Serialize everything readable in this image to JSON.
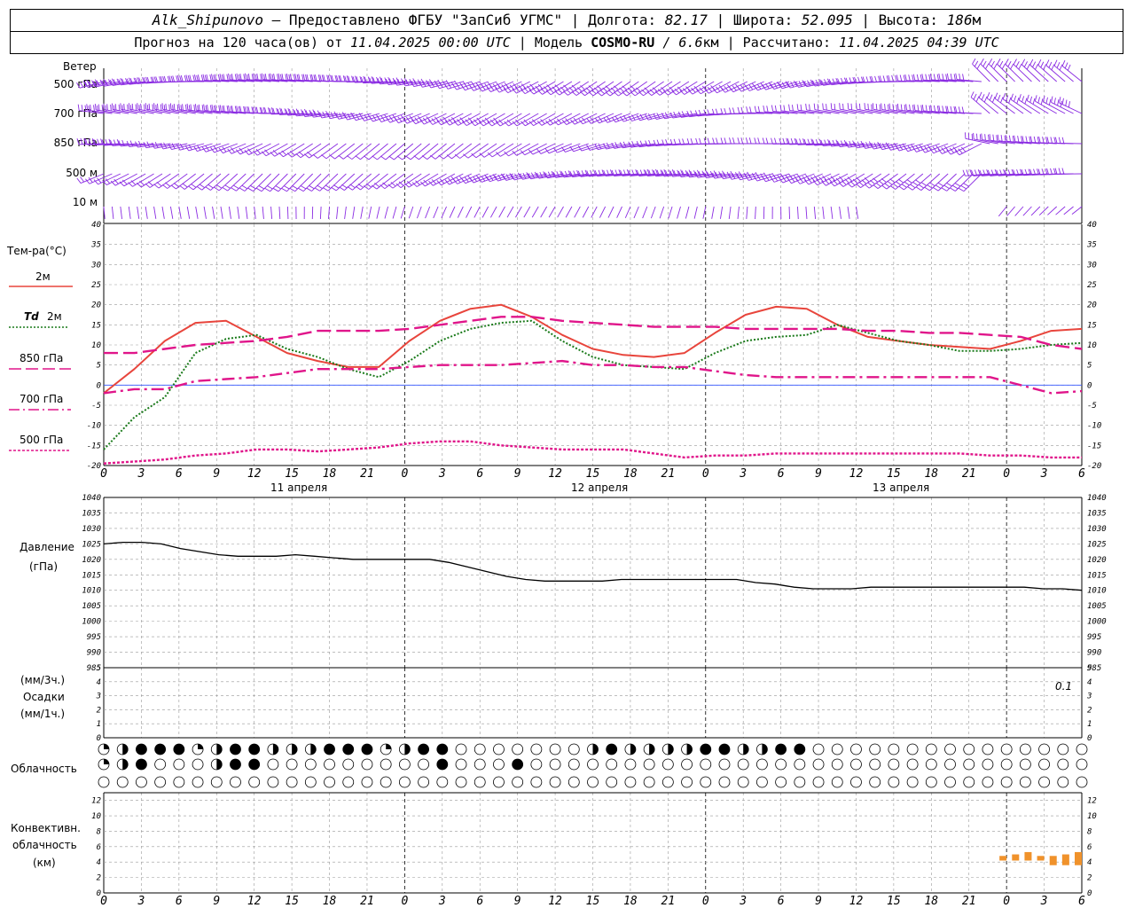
{
  "header": {
    "station": "Alk_Shipunovo",
    "provider": " – Предоставлено ФГБУ \"ЗапСиб УГМС\" | Долгота: ",
    "lon": "82.17",
    "lat_label": " | Широта: ",
    "lat": "52.095",
    "alt_label": " | Высота: ",
    "alt": "186",
    "alt_unit": "м",
    "fc_label": "Прогноз на 120 часа(ов) от ",
    "fc_start": "11.04.2025 00:00 UTC",
    "model_label": " | Модель ",
    "model": "COSMO-RU",
    "res": " / 6.6",
    "res_unit": "км",
    "calc_label": " | Рассчитано: ",
    "calc": "11.04.2025 04:39 UTC"
  },
  "labels": {
    "wind": "Ветер",
    "wind_levels": [
      "500 гПа",
      "700 гПа",
      "850 гПа",
      "500 м",
      "10  м"
    ],
    "temp": "Тем-ра(°С)",
    "t2m": "2м",
    "td": "Td",
    "td2": "2м",
    "l850": "850 гПа",
    "l700": "700 гПа",
    "l500": "500 гПа",
    "pressure": "Давление",
    "pressure_unit": "(гПа)",
    "precip_3h": "(мм/3ч.)",
    "precip": "Осадки",
    "precip_1h": "(мм/1ч.)",
    "precip_note": "0.1",
    "cloud": "Облачность",
    "conv1": "Конвективн.",
    "conv2": "облачность",
    "conv3": "(км)",
    "days": [
      "11 апреля",
      "12 апреля",
      "13 апреля"
    ],
    "hour_ticks": [
      "0",
      "3",
      "6",
      "9",
      "12",
      "15",
      "18",
      "21",
      "0",
      "3",
      "6",
      "9",
      "12",
      "15",
      "18",
      "21",
      "0",
      "3",
      "6",
      "9",
      "12",
      "15",
      "18",
      "21",
      "0",
      "3",
      "6"
    ]
  },
  "colors": {
    "t2m": "#e8453c",
    "td": "#1a7a1a",
    "p850": "#e0158a",
    "p700": "#e0158a",
    "p500": "#e0158a",
    "wind": "#8a2be2",
    "pressure": "#000000",
    "conv": "#f0922b",
    "zero": "#3355ff"
  },
  "chart_data": [
    {
      "type": "line",
      "title": "Тем-ра(°С)",
      "x_hours": [
        0,
        3,
        6,
        9,
        12,
        15,
        18,
        21,
        24,
        27,
        30,
        33,
        36,
        39,
        42,
        45,
        48,
        51,
        54,
        57,
        60,
        63,
        66,
        69,
        72,
        75,
        78
      ],
      "ylim": [
        -20,
        40
      ],
      "series": [
        {
          "name": "2м",
          "values": [
            -2,
            4,
            11,
            15.5,
            16,
            12,
            8,
            6,
            4.5,
            4.5,
            11,
            16,
            19,
            20,
            17,
            12.5,
            9,
            7.5,
            7,
            8,
            13,
            17.5,
            19.5,
            19,
            15,
            12,
            11,
            10,
            9.5,
            9,
            11,
            13.5,
            14
          ]
        },
        {
          "name": "Td 2м",
          "values": [
            -16,
            -8,
            -3,
            8,
            11.5,
            12.5,
            9,
            7,
            4,
            2,
            6,
            11,
            14,
            15.5,
            16,
            11,
            7,
            5,
            4.5,
            4,
            8,
            11,
            12,
            12.5,
            15,
            13,
            11,
            10,
            8.5,
            8.5,
            9,
            10,
            10.5
          ]
        },
        {
          "name": "850 гПа",
          "values": [
            8,
            8,
            9,
            10,
            10.5,
            11,
            12,
            13.5,
            13.5,
            13.5,
            14,
            15,
            16,
            17,
            17,
            16,
            15.5,
            15,
            14.5,
            14.5,
            14.5,
            14,
            14,
            14,
            14,
            13.5,
            13.5,
            13,
            13,
            12.5,
            12,
            10,
            9
          ]
        },
        {
          "name": "700 гПа",
          "values": [
            -2,
            -1,
            -1,
            1,
            1.5,
            2,
            3,
            4,
            4,
            4,
            4.5,
            5,
            5,
            5,
            5.5,
            6,
            5,
            5,
            4.5,
            4.5,
            3.5,
            2.5,
            2,
            2,
            2,
            2,
            2,
            2,
            2,
            2,
            0,
            -2,
            -1.5
          ]
        },
        {
          "name": "500 гПа",
          "values": [
            -19.5,
            -19,
            -18.5,
            -17.5,
            -17,
            -16,
            -16,
            -16.5,
            -16,
            -15.5,
            -14.5,
            -14,
            -14,
            -15,
            -15.5,
            -16,
            -16,
            -16,
            -17,
            -18,
            -17.5,
            -17.5,
            -17,
            -17,
            -17,
            -17,
            -17,
            -17,
            -17,
            -17.5,
            -17.5,
            -18,
            -18
          ]
        }
      ]
    },
    {
      "type": "line",
      "title": "Давление",
      "ylabel": "(гПа)",
      "ylim": [
        985,
        1040
      ],
      "series": [
        {
          "name": "Давление",
          "values": [
            1025,
            1025.5,
            1025.5,
            1025,
            1023.5,
            1022.5,
            1021.5,
            1021,
            1021,
            1021,
            1021.5,
            1021,
            1020.5,
            1020,
            1020,
            1020,
            1020,
            1020,
            1019,
            1017.5,
            1016,
            1014.5,
            1013.5,
            1013,
            1013,
            1013,
            1013,
            1013.5,
            1013.5,
            1013.5,
            1013.5,
            1013.5,
            1013.5,
            1013.5,
            1012.5,
            1012,
            1011,
            1010.5,
            1010.5,
            1010.5,
            1011,
            1011,
            1011,
            1011,
            1011,
            1011,
            1011,
            1011,
            1011,
            1010.5,
            1010.5,
            1010
          ]
        }
      ]
    },
    {
      "type": "bar",
      "title": "Конвективн. облачность",
      "ylabel": "(км)",
      "ylim": [
        0,
        13
      ],
      "series": [
        {
          "name": "top",
          "x_hours": [
            72,
            73,
            74,
            75,
            76,
            77,
            78
          ],
          "values": [
            4.8,
            5,
            5.3,
            4.8,
            4.8,
            5,
            5.3
          ]
        },
        {
          "name": "base",
          "x_hours": [
            72,
            73,
            74,
            75,
            76,
            77,
            78
          ],
          "values": [
            4.2,
            4.2,
            4.2,
            4.2,
            3.6,
            3.6,
            3.6
          ]
        }
      ]
    }
  ]
}
